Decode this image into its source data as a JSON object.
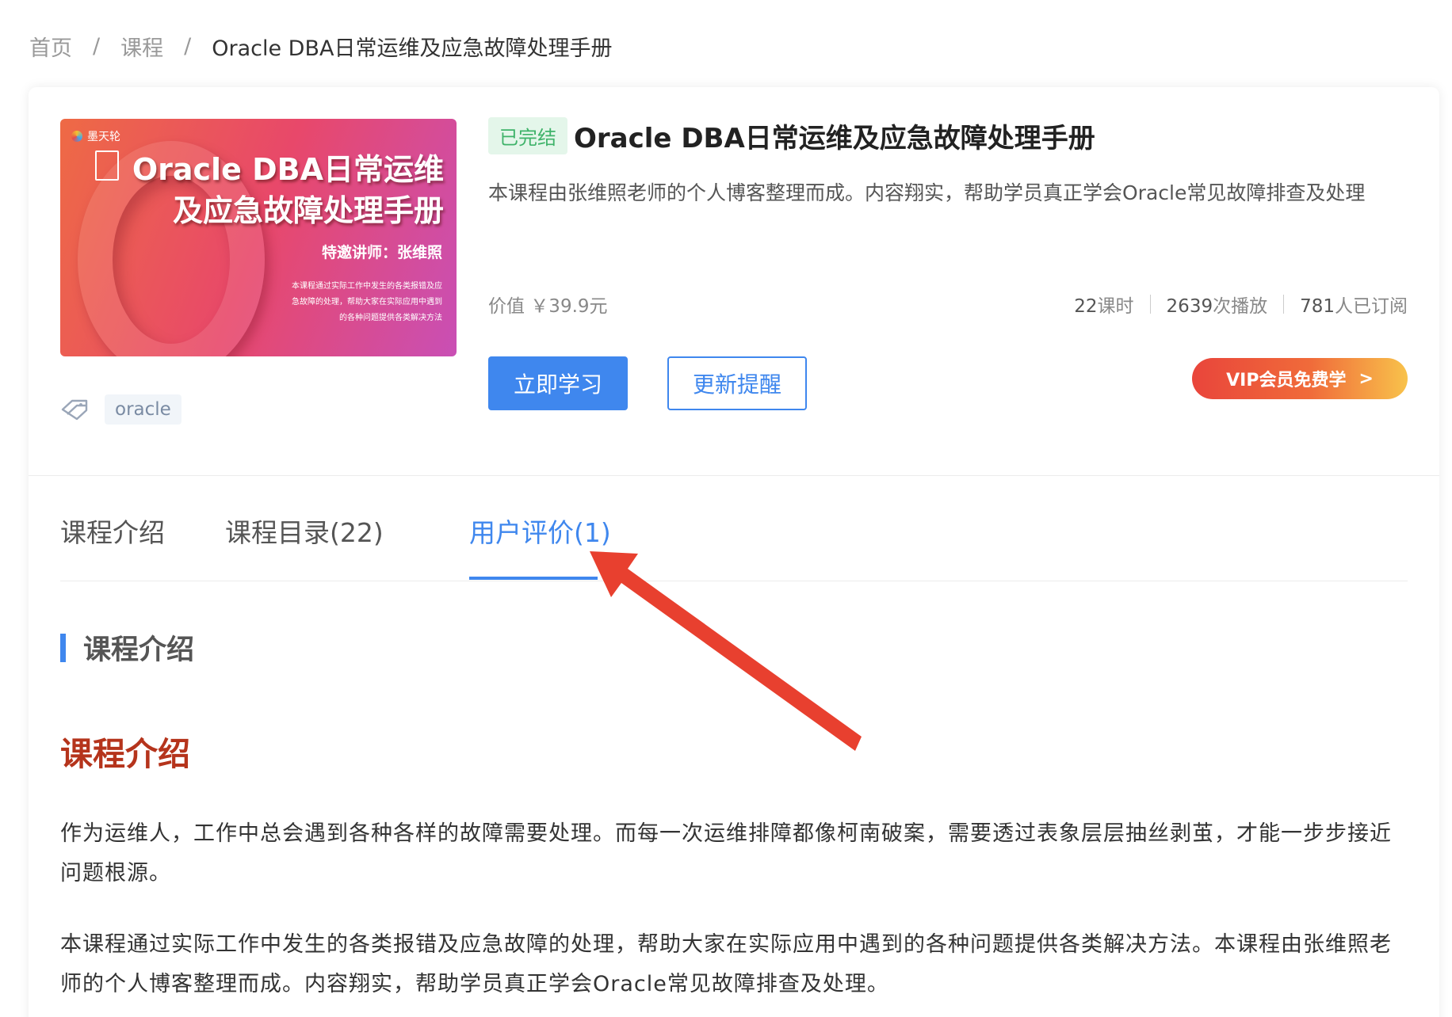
{
  "breadcrumb": {
    "items": [
      "首页",
      "课程",
      "Oracle DBA日常运维及应急故障处理手册"
    ],
    "separator": "/"
  },
  "course": {
    "status": "已完结",
    "title": "Oracle DBA日常运维及应急故障处理手册",
    "description": "本课程由张维照老师的个人博客整理而成。内容翔实，帮助学员真正学会Oracle常见故障排查及处理",
    "price": "价值 ￥39.9元",
    "lessons": {
      "num": "22",
      "unit": "课时"
    },
    "plays": {
      "num": "2639",
      "unit": "次播放"
    },
    "subscribers": {
      "num": "781",
      "unit": "人已订阅"
    },
    "tag": "oracle"
  },
  "cover": {
    "brand": "墨天轮",
    "title_line1": "Oracle DBA日常运维",
    "title_line2": "及应急故障处理手册",
    "lecturer": "特邀讲师：张维照",
    "desc_line1": "本课程通过实际工作中发生的各类报错及应",
    "desc_line2": "急故障的处理，帮助大家在实际应用中遇到",
    "desc_line3": "的各种问题提供各类解决方法"
  },
  "buttons": {
    "study": "立即学习",
    "remind": "更新提醒",
    "vip": "VIP会员免费学",
    "vip_arrow": ">"
  },
  "tabs": [
    {
      "label": "课程介绍",
      "active": false
    },
    {
      "label": "课程目录(22)",
      "active": false
    },
    {
      "label": "用户评价(1)",
      "active": true
    }
  ],
  "section": {
    "title": "课程介绍"
  },
  "intro": {
    "heading": "课程介绍",
    "paragraph1": "作为运维人，工作中总会遇到各种各样的故障需要处理。而每一次运维排障都像柯南破案，需要透过表象层层抽丝剥茧，才能一步步接近问题根源。",
    "paragraph2": "本课程通过实际工作中发生的各类报错及应急故障的处理，帮助大家在实际应用中遇到的各种问题提供各类解决方法。本课程由张维照老师的个人博客整理而成。内容翔实，帮助学员真正学会Oracle常见故障排查及处理。"
  },
  "colors": {
    "accent": "#3f87ee",
    "status_green": "#3fb36a",
    "heading_red": "#b5341c",
    "annotation_arrow": "#e8402f"
  },
  "icons": [
    "tag-icon",
    "document-icon",
    "brand-logo-icon"
  ]
}
